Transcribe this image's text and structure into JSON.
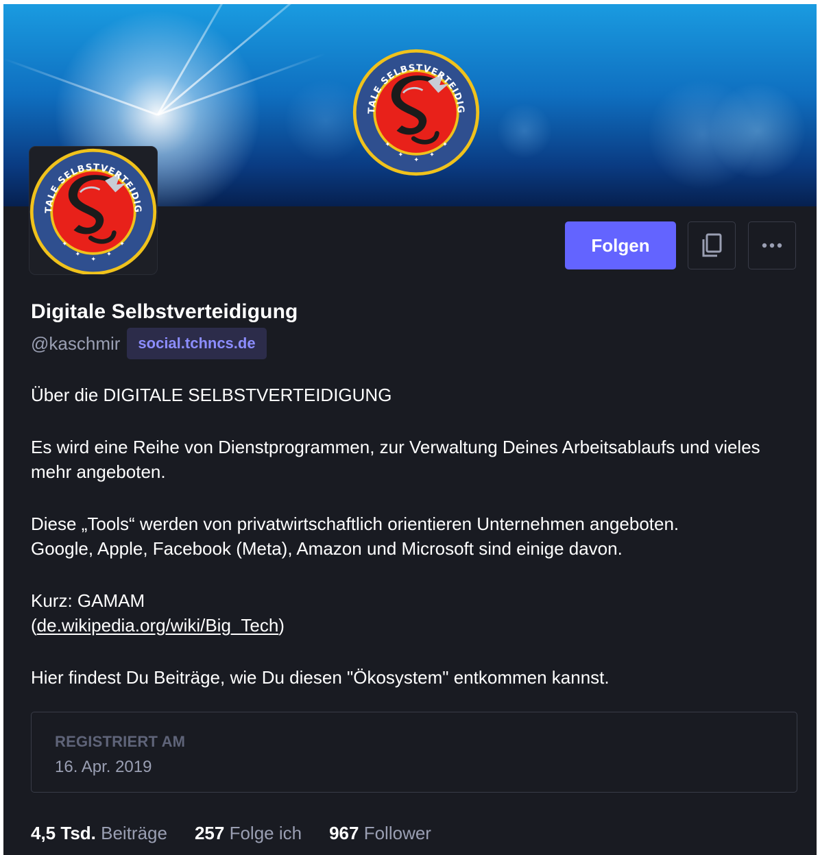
{
  "profile": {
    "display_name": "Digitale Selbstverteidigung",
    "handle": "@kaschmir",
    "domain": "social.tchncs.de"
  },
  "emblem": {
    "text": "DIGITALE SELBSTVERTEIDIGUNG",
    "colors": {
      "red": "#e8211a",
      "navy": "#2f4f8f",
      "gold": "#f0c21c"
    }
  },
  "actions": {
    "follow_label": "Folgen",
    "copy_icon": "copy-icon",
    "more_icon": "more-horizontal-icon"
  },
  "bio": {
    "p1": "Über die DIGITALE SELBSTVERTEIDIGUNG",
    "p2": "Es wird eine Reihe von Dienstprogrammen, zur Verwaltung Deines Arbeitsablaufs und vieles mehr angeboten.",
    "p3_line1": "Diese „Tools“ werden von privatwirtschaftlich orientieren Unternehmen angeboten.",
    "p3_line2": "Google, Apple, Facebook (Meta), Amazon und Microsoft sind einige davon.",
    "p4_line1": "Kurz: GAMAM",
    "p4_open": "(",
    "p4_link": "de.wikipedia.org/wiki/Big_Tech",
    "p4_close": ")",
    "p5": "Hier findest Du Beiträge, wie Du diesen \"Ökosystem\" entkommen kannst."
  },
  "joined": {
    "label": "REGISTRIERT AM",
    "date": "16. Apr. 2019"
  },
  "stats": {
    "posts_count": "4,5 Tsd.",
    "posts_label": "Beiträge",
    "following_count": "257",
    "following_label": "Folge ich",
    "followers_count": "967",
    "followers_label": "Follower"
  },
  "colors": {
    "background": "#191b22",
    "accent": "#6364ff",
    "muted": "#9a9fb3",
    "border": "#393c48"
  }
}
